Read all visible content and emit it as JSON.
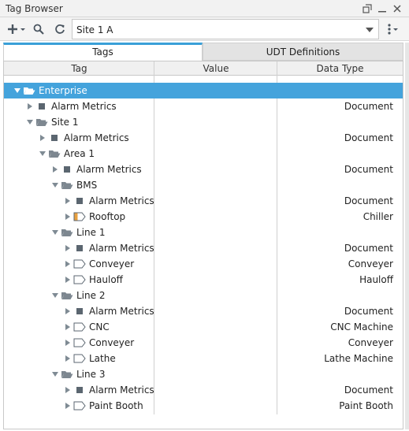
{
  "window": {
    "title": "Tag Browser"
  },
  "toolbar": {
    "provider_value": "Site 1 A",
    "add_icon": "plus-dropdown-icon",
    "search_icon": "search-icon",
    "refresh_icon": "refresh-icon",
    "menu_icon": "kebab-menu-icon"
  },
  "tabs": [
    {
      "label": "Tags",
      "active": true
    },
    {
      "label": "UDT Definitions",
      "active": false
    }
  ],
  "columns": {
    "tag": "Tag",
    "value": "Value",
    "datatype": "Data Type"
  },
  "colors": {
    "selection": "#44a3dc",
    "accent": "#3aa0d8",
    "folder": "#7d8790",
    "udt_orange": "#e8a040"
  },
  "tree": [
    {
      "label": "Enterprise",
      "level": 0,
      "icon": "folder-open-icon",
      "expander": "expanded",
      "datatype": "",
      "selected": true
    },
    {
      "label": "Alarm Metrics",
      "level": 1,
      "icon": "tag-square-icon",
      "expander": "collapsed",
      "datatype": "Document"
    },
    {
      "label": "Site 1",
      "level": 1,
      "icon": "folder-open-icon",
      "expander": "expanded",
      "datatype": ""
    },
    {
      "label": "Alarm Metrics",
      "level": 2,
      "icon": "tag-square-icon",
      "expander": "collapsed",
      "datatype": "Document"
    },
    {
      "label": "Area 1",
      "level": 2,
      "icon": "folder-open-icon",
      "expander": "expanded",
      "datatype": ""
    },
    {
      "label": "Alarm Metrics",
      "level": 3,
      "icon": "tag-square-icon",
      "expander": "collapsed",
      "datatype": "Document"
    },
    {
      "label": "BMS",
      "level": 3,
      "icon": "folder-open-icon",
      "expander": "expanded",
      "datatype": ""
    },
    {
      "label": "Alarm Metrics",
      "level": 4,
      "icon": "tag-square-icon",
      "expander": "collapsed",
      "datatype": "Document"
    },
    {
      "label": "Rooftop",
      "level": 4,
      "icon": "udt-instance-orange-icon",
      "expander": "collapsed",
      "datatype": "Chiller"
    },
    {
      "label": "Line 1",
      "level": 3,
      "icon": "folder-open-icon",
      "expander": "expanded",
      "datatype": ""
    },
    {
      "label": "Alarm Metrics",
      "level": 4,
      "icon": "tag-square-icon",
      "expander": "collapsed",
      "datatype": "Document"
    },
    {
      "label": "Conveyer",
      "level": 4,
      "icon": "udt-instance-icon",
      "expander": "collapsed",
      "datatype": "Conveyer"
    },
    {
      "label": "Hauloff",
      "level": 4,
      "icon": "udt-instance-icon",
      "expander": "collapsed",
      "datatype": "Hauloff"
    },
    {
      "label": "Line 2",
      "level": 3,
      "icon": "folder-open-icon",
      "expander": "expanded",
      "datatype": ""
    },
    {
      "label": "Alarm Metrics",
      "level": 4,
      "icon": "tag-square-icon",
      "expander": "collapsed",
      "datatype": "Document"
    },
    {
      "label": "CNC",
      "level": 4,
      "icon": "udt-instance-icon",
      "expander": "collapsed",
      "datatype": "CNC Machine"
    },
    {
      "label": "Conveyer",
      "level": 4,
      "icon": "udt-instance-icon",
      "expander": "collapsed",
      "datatype": "Conveyer"
    },
    {
      "label": "Lathe",
      "level": 4,
      "icon": "udt-instance-icon",
      "expander": "collapsed",
      "datatype": "Lathe Machine"
    },
    {
      "label": "Line 3",
      "level": 3,
      "icon": "folder-open-icon",
      "expander": "expanded",
      "datatype": ""
    },
    {
      "label": "Alarm Metrics",
      "level": 4,
      "icon": "tag-square-icon",
      "expander": "collapsed",
      "datatype": "Document"
    },
    {
      "label": "Paint Booth",
      "level": 4,
      "icon": "udt-instance-icon",
      "expander": "collapsed",
      "datatype": "Paint Booth"
    }
  ]
}
